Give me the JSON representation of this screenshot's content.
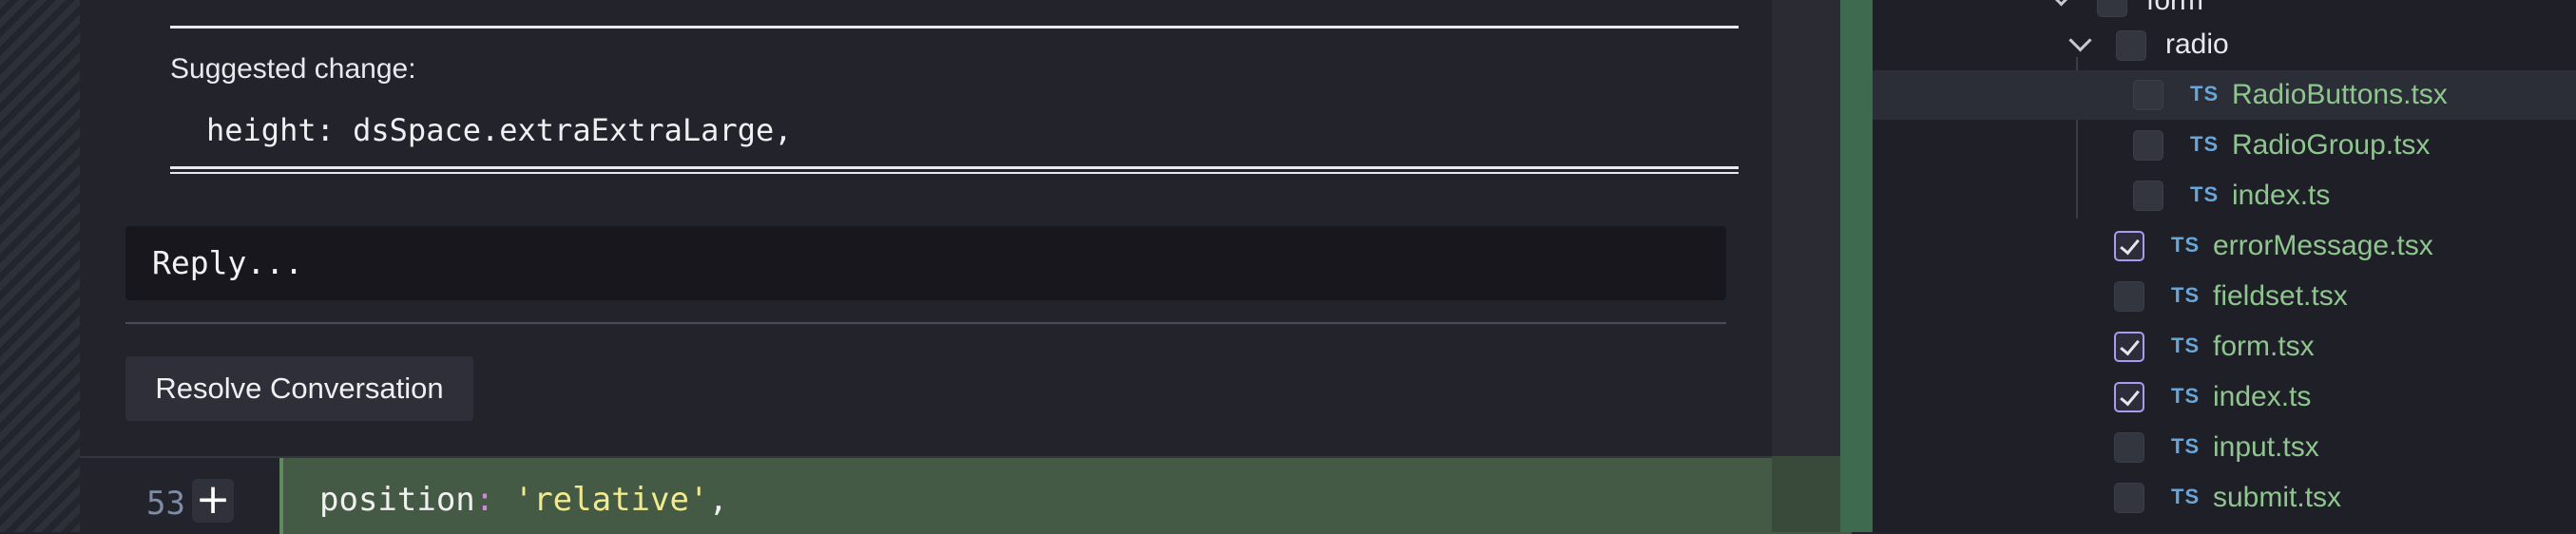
{
  "comment": {
    "suggested_label": "Suggested change:",
    "suggested_code": "height: dsSpace.extraExtraLarge,",
    "reply_placeholder": "Reply...",
    "resolve_label": "Resolve Conversation"
  },
  "diff": {
    "line_number": "53",
    "add_symbol": "+",
    "code": {
      "key": "position",
      "colon": ":",
      "value": "'relative'",
      "comma": ","
    }
  },
  "file_tree": {
    "folders": [
      {
        "name": "form"
      },
      {
        "name": "radio",
        "expanded": true
      }
    ],
    "files": [
      {
        "icon": "TS",
        "name": "RadioButtons.tsx",
        "checked": false,
        "highlighted": true
      },
      {
        "icon": "TS",
        "name": "RadioGroup.tsx",
        "checked": false
      },
      {
        "icon": "TS",
        "name": "index.ts",
        "checked": false
      },
      {
        "icon": "TS",
        "name": "errorMessage.tsx",
        "checked": true
      },
      {
        "icon": "TS",
        "name": "fieldset.tsx",
        "checked": false
      },
      {
        "icon": "TS",
        "name": "form.tsx",
        "checked": true
      },
      {
        "icon": "TS",
        "name": "index.ts",
        "checked": true
      },
      {
        "icon": "TS",
        "name": "input.tsx",
        "checked": false
      },
      {
        "icon": "TS",
        "name": "submit.tsx",
        "checked": false
      }
    ]
  },
  "colors": {
    "added_line_bg": "#455a45",
    "checkbox_checked_border": "#a99cf0",
    "file_name": "#8fc68f",
    "ts_badge": "#6aa5d8"
  }
}
